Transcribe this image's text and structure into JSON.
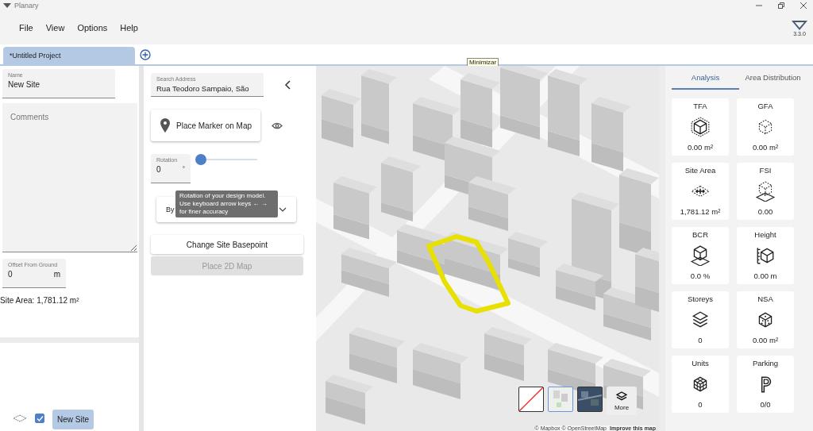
{
  "window": {
    "title": "Planary"
  },
  "menu": [
    "File",
    "View",
    "Options",
    "Help"
  ],
  "version": "3.3.0",
  "tabs": [
    {
      "label": "*Untitled Project",
      "selected": true
    }
  ],
  "hover_tooltip": "Minimizar",
  "site_form": {
    "name": {
      "label": "Name",
      "value": "New Site"
    },
    "comments": {
      "placeholder": "Comments"
    },
    "offset": {
      "label": "Offset From Ground",
      "value": "0",
      "unit": "m"
    },
    "site_area": "Site Area: 1,781.12 m²"
  },
  "layers": [
    {
      "label": "New Site",
      "checked": true,
      "selected": true
    }
  ],
  "location_panel": {
    "search": {
      "label": "Search Address",
      "value": "Rua Teodoro Sampaio, São"
    },
    "place_marker": "Place Marker on Map",
    "rotation": {
      "label": "Rotation",
      "value": "0",
      "unit": "°",
      "level": 0
    },
    "dropdown": {
      "value": "By"
    },
    "tooltip": [
      "Rotation of your design model.",
      "Use keyboard arrow keys ← →",
      "for finer accuracy"
    ],
    "buttons": [
      {
        "label": "Change Site Basepoint",
        "disabled": false
      },
      {
        "label": "Place 2D Map",
        "disabled": true
      }
    ]
  },
  "map": {
    "styles": [
      {
        "kind": "none",
        "selected": false
      },
      {
        "kind": "streets",
        "selected": true
      },
      {
        "kind": "satellite",
        "selected": false
      }
    ],
    "more": "More",
    "attribution": "© Mapbox © OpenStreetMap",
    "improve_link": "Improve this map"
  },
  "analysis": {
    "tabs": [
      {
        "label": "Analysis",
        "selected": true
      },
      {
        "label": "Area Distribution",
        "selected": false
      }
    ],
    "cards": [
      {
        "label": "TFA",
        "value": "0.00 m²"
      },
      {
        "label": "GFA",
        "value": "0.00 m²"
      },
      {
        "label": "Site Area",
        "value": "1,781.12 m²"
      },
      {
        "label": "FSI",
        "value": "0.00"
      },
      {
        "label": "BCR",
        "value": "0.0 %"
      },
      {
        "label": "Height",
        "value": "0.00 m"
      },
      {
        "label": "Storeys",
        "value": "0"
      },
      {
        "label": "NSA",
        "value": "0.00 m²"
      },
      {
        "label": "Units",
        "value": "0"
      },
      {
        "label": "Parking",
        "value": "0/0"
      }
    ]
  }
}
